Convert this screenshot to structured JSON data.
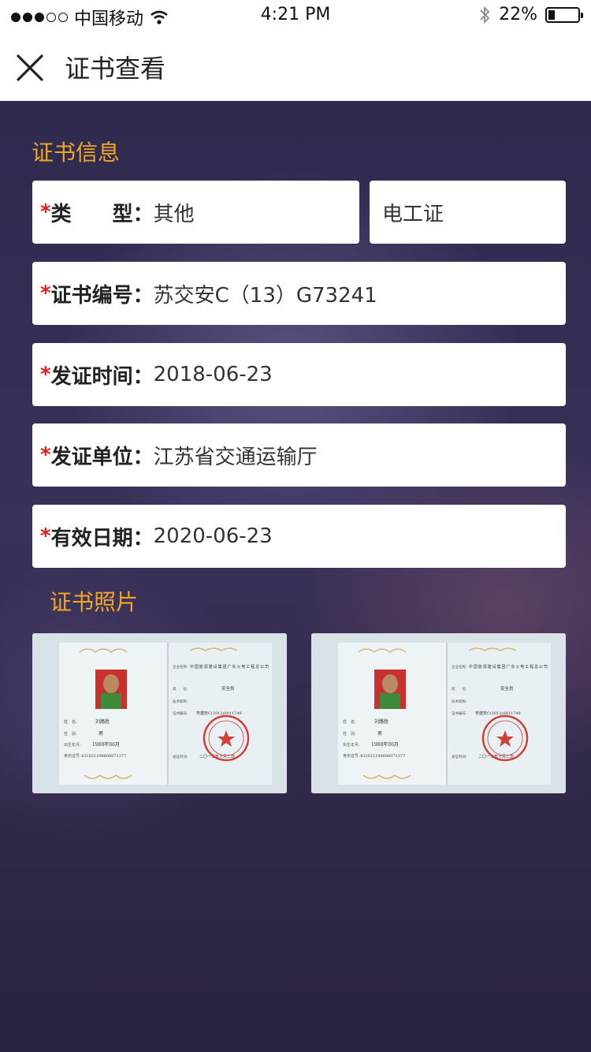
{
  "status": {
    "carrier": "中国移动",
    "time": "4:21 PM",
    "battery_percent": "22%",
    "battery_level": 0.22
  },
  "nav": {
    "title": "证书查看"
  },
  "info": {
    "section_title": "证书信息",
    "fields": [
      {
        "required": "*",
        "label": "类　　型：",
        "value": "其他"
      },
      {
        "value": "电工证"
      },
      {
        "required": "*",
        "label": "证书编号：",
        "value": "苏交安C（13）G73241"
      },
      {
        "required": "*",
        "label": "发证时间：",
        "value": "2018-06-23"
      },
      {
        "required": "*",
        "label": "发证单位：",
        "value": "江苏省交通运输厅"
      },
      {
        "required": "*",
        "label": "有效日期：",
        "value": "2020-06-23"
      }
    ]
  },
  "photos": {
    "section_title": "证书照片",
    "items": [
      {
        "org_label": "企业名称:",
        "org_name": "中国能源建设集团广东火电工程总公司",
        "post_label": "岗　　位:",
        "post": "安全员",
        "title_label": "技术职称:",
        "cert_no_label": "证书编号:",
        "cert_no": "粤建安C(2012)0011749",
        "name_label": "姓　名:",
        "name": "刘路胜",
        "gender_label": "性　别:",
        "gender": "男",
        "birth_label": "出生年月:",
        "birth": "1988年06月",
        "id_label": "身份证号:",
        "id": "431021198806071377",
        "issue_label": "发证时间:",
        "issue_date": "二〇一二年十月二日",
        "seal_text": "广东省住房和城乡建设厅 证件专用章"
      },
      {
        "org_label": "企业名称:",
        "org_name": "中国能源建设集团广东火电工程总公司",
        "post_label": "岗　　位:",
        "post": "安全员",
        "title_label": "技术职称:",
        "cert_no_label": "证书编号:",
        "cert_no": "粤建安C(2012)0011749",
        "name_label": "姓　名:",
        "name": "刘路胜",
        "gender_label": "性　别:",
        "gender": "男",
        "birth_label": "出生年月:",
        "birth": "1988年06月",
        "id_label": "身份证号:",
        "id": "431021198806071377",
        "issue_label": "发证时间:",
        "issue_date": "二〇一二年十月二日",
        "seal_text": "广东省住房和城乡建设厅 证件专用章"
      }
    ]
  }
}
